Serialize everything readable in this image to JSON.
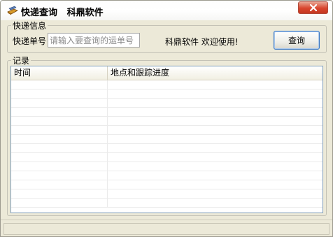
{
  "window": {
    "title": "快递查询   科鼎软件",
    "close_icon": "close-icon"
  },
  "info_group": {
    "label": "快递信息",
    "tracking_label": "快递单号",
    "tracking_placeholder": "请输入要查询的运单号",
    "tracking_value": "",
    "welcome_text": "科鼎软件 欢迎使用!",
    "query_button": "查询"
  },
  "records_group": {
    "label": "记录",
    "columns": [
      "时间",
      "地点和跟踪进度"
    ],
    "rows": []
  },
  "status_bar": {
    "text": ""
  }
}
